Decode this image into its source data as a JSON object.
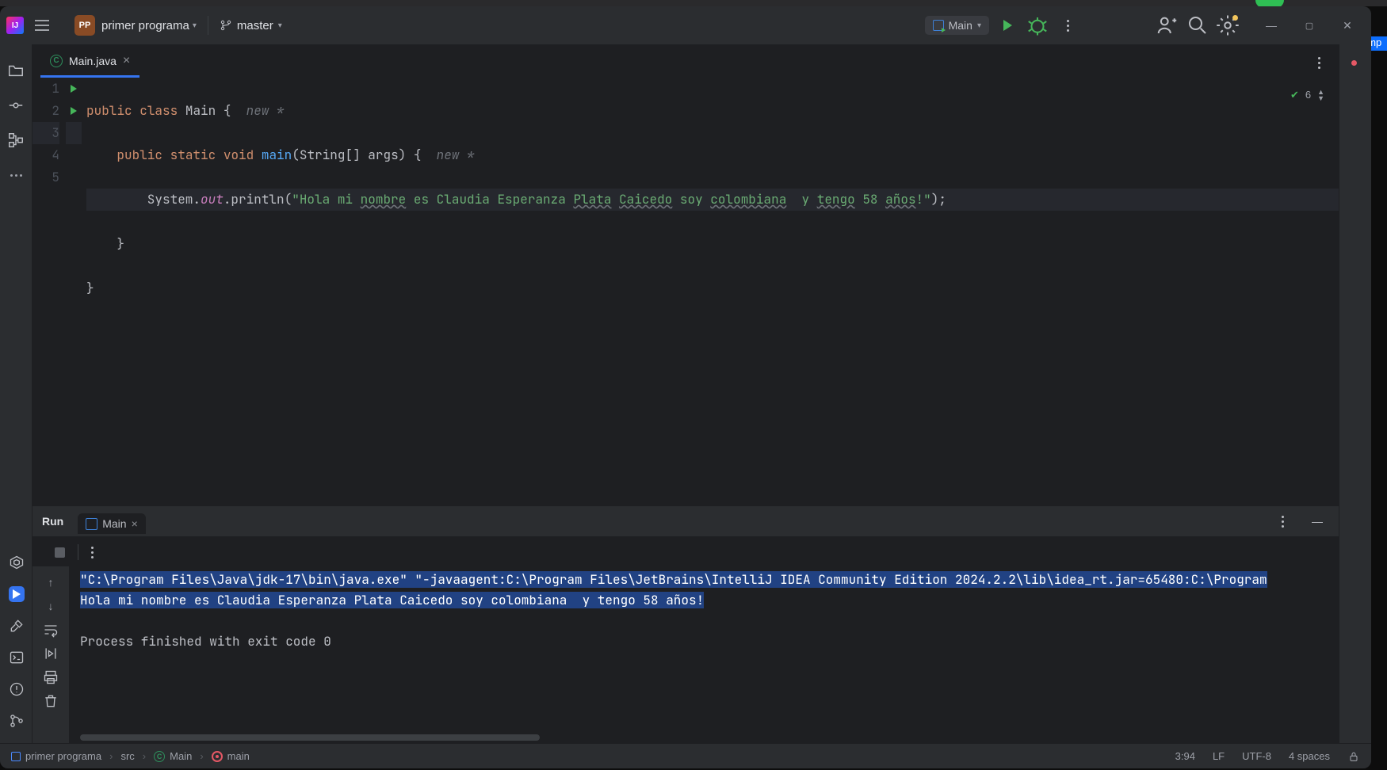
{
  "titlebar": {
    "project_initials": "PP",
    "project_name": "primer programa",
    "branch": "master",
    "run_config": "Main"
  },
  "tabs": {
    "file1": "Main.java"
  },
  "inspections": {
    "count": "6"
  },
  "code": {
    "l1a": "public",
    "l1b": "class",
    "l1c": "Main {",
    "l1h": "new *",
    "l2a": "public",
    "l2b": "static",
    "l2c": "void",
    "l2d": "main",
    "l2e": "(String[] args) {",
    "l2h": "new *",
    "l3a": "        System.",
    "l3b": "out",
    "l3c": ".println(",
    "l3d": "\"Hola mi ",
    "l3e": "nombre",
    "l3f": " es Claudia Esperanza ",
    "l3g": "Plata",
    "l3h": " ",
    "l3i": "Caicedo",
    "l3j": " soy ",
    "l3k": "colombiana",
    "l3l": "  y ",
    "l3m": "tengo",
    "l3n": " 58 ",
    "l3o": "años",
    "l3p": "!\"",
    "l3q": ");",
    "l4": "    }",
    "l5": "}"
  },
  "gutter": {
    "n1": "1",
    "n2": "2",
    "n3": "3",
    "n4": "4",
    "n5": "5"
  },
  "run": {
    "title": "Run",
    "tab": "Main",
    "line1": "\"C:\\Program Files\\Java\\jdk-17\\bin\\java.exe\" \"-javaagent:C:\\Program Files\\JetBrains\\IntelliJ IDEA Community Edition 2024.2.2\\lib\\idea_rt.jar=65480:C:\\Program",
    "line2": "Hola mi nombre es Claudia Esperanza Plata Caicedo soy colombiana  y tengo 58 años!",
    "line3": "",
    "line4": "Process finished with exit code 0"
  },
  "breadcrumbs": {
    "b1": "primer programa",
    "b2": "src",
    "b3": "Main",
    "b4": "main"
  },
  "status": {
    "pos": "3:94",
    "sep": "LF",
    "enc": "UTF-8",
    "indent": "4 spaces"
  },
  "external": {
    "right_label": "omp"
  }
}
